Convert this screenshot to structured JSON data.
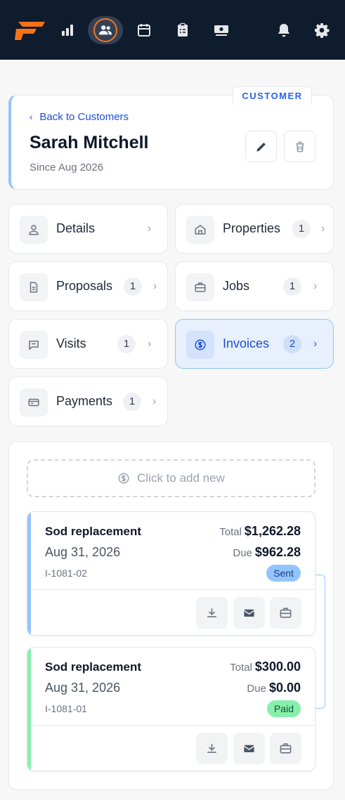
{
  "nav": {
    "logo": "brand-logo",
    "items": [
      "reports-icon",
      "customers-icon",
      "calendar-icon",
      "clipboard-icon",
      "money-icon"
    ],
    "right": [
      "bell-icon",
      "gear-icon"
    ]
  },
  "customer": {
    "tag": "CUSTOMER",
    "back_label": "Back to Customers",
    "name": "Sarah Mitchell",
    "since": "Since Aug 2026"
  },
  "tiles": [
    {
      "label": "Details",
      "count": ""
    },
    {
      "label": "Properties",
      "count": "1"
    },
    {
      "label": "Proposals",
      "count": "1"
    },
    {
      "label": "Jobs",
      "count": "1"
    },
    {
      "label": "Visits",
      "count": "1"
    },
    {
      "label": "Invoices",
      "count": "2"
    },
    {
      "label": "Payments",
      "count": "1"
    }
  ],
  "panel": {
    "add_new": "Click to add new"
  },
  "invoices": [
    {
      "title": "Sod replacement",
      "date": "Aug 31, 2026",
      "number": "I-1081-02",
      "total_label": "Total",
      "total": "$1,262.28",
      "due_label": "Due",
      "due": "$962.28",
      "status": "Sent",
      "accent": "#93c5fd",
      "status_bg": "#93c5fd",
      "status_color": "#1e3a8a"
    },
    {
      "title": "Sod replacement",
      "date": "Aug 31, 2026",
      "number": "I-1081-01",
      "total_label": "Total",
      "total": "$300.00",
      "due_label": "Due",
      "due": "$0.00",
      "status": "Paid",
      "accent": "#86efac",
      "status_bg": "#86efac",
      "status_color": "#14532d"
    }
  ]
}
